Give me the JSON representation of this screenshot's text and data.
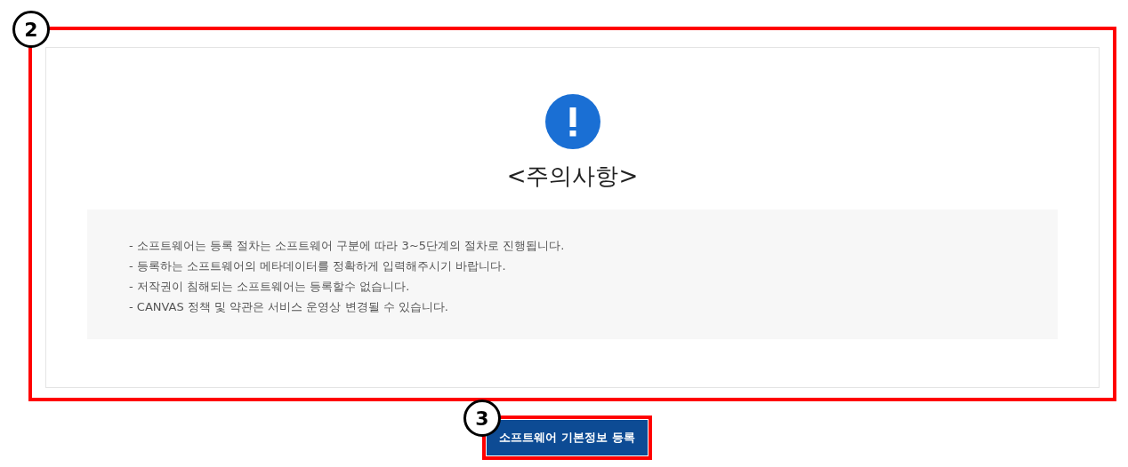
{
  "callouts": [
    {
      "label": "2"
    },
    {
      "label": "3"
    }
  ],
  "notice": {
    "title": "<주의사항>",
    "lines": [
      "- 소프트웨어는 등록 절차는 소프트웨어 구분에 따라 3~5단계의 절차로 진행됩니다.",
      "- 등록하는 소프트웨어의 메타데이터를 정확하게 입력해주시기 바랍니다.",
      "- 저작권이 침해되는 소프트웨어는 등록할수 없습니다.",
      "- CANVAS 정책 및 약관은 서비스 운영상 변경될 수 있습니다."
    ]
  },
  "button": {
    "label": "소프트웨어 기본정보 등록"
  }
}
